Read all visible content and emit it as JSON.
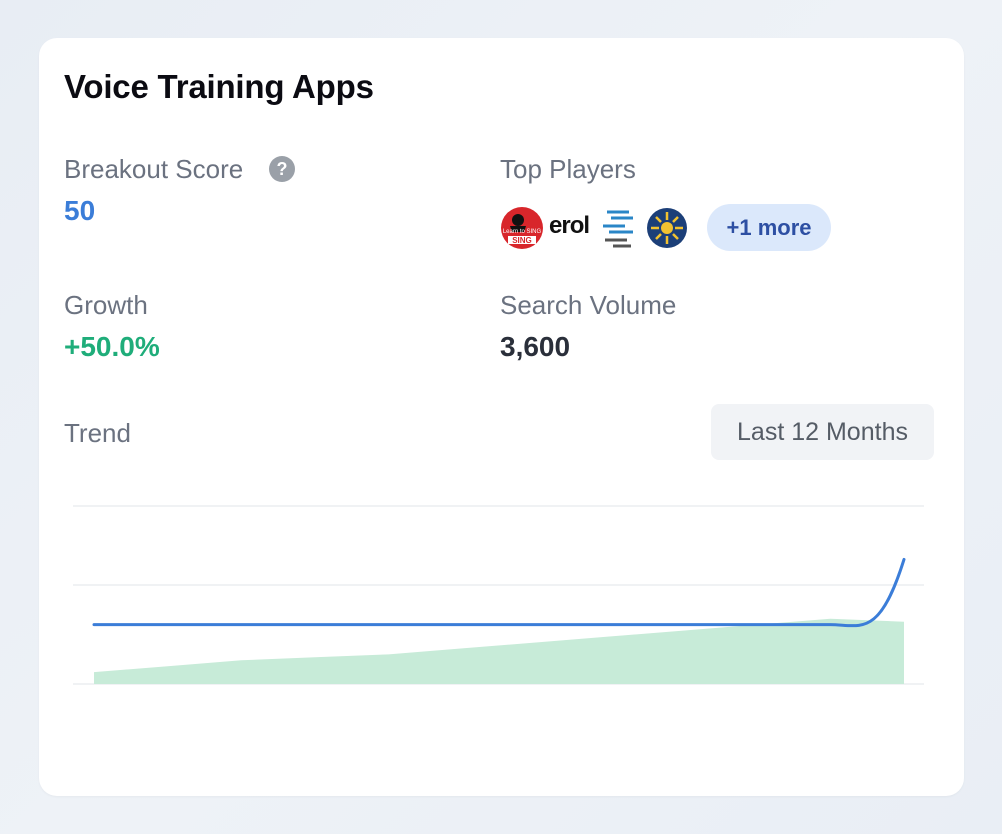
{
  "card": {
    "title": "Voice Training Apps",
    "breakout_score": {
      "label": "Breakout Score",
      "value": "50",
      "help_glyph": "?"
    },
    "top_players": {
      "label": "Top Players",
      "logos": [
        {
          "icon": "learn-to-sing-logo",
          "text": "Learn to SING"
        },
        {
          "icon": "erol-logo",
          "text": "erol"
        },
        {
          "icon": "stacked-s-logo"
        },
        {
          "icon": "sunburst-logo"
        }
      ],
      "more_label": "+1 more"
    },
    "growth": {
      "label": "Growth",
      "value": "+50.0%"
    },
    "search_volume": {
      "label": "Search Volume",
      "value": "3,600"
    },
    "trend": {
      "label": "Trend",
      "range_label": "Last 12 Months"
    }
  },
  "colors": {
    "accent_blue": "#3b7dd8",
    "growth_green": "#1fad7a",
    "area_green": "#c7ebd8",
    "label_gray": "#6b7280"
  },
  "chart_data": {
    "type": "line",
    "title": "",
    "xlabel": "",
    "ylabel": "",
    "x": [
      1,
      2,
      3,
      4,
      5,
      6,
      7,
      8,
      9,
      10,
      11,
      12
    ],
    "ylim": [
      0,
      3
    ],
    "grid": true,
    "series": [
      {
        "values": [
          1,
          1,
          1,
          1,
          1,
          1,
          1,
          1,
          1,
          1,
          1,
          2.1
        ],
        "color": "#3b7dd8"
      },
      {
        "type": "area",
        "values": [
          0.2,
          0.3,
          0.4,
          0.45,
          0.5,
          0.6,
          0.7,
          0.8,
          0.9,
          1.0,
          1.1,
          1.05
        ],
        "color": "#c7ebd8"
      }
    ]
  }
}
